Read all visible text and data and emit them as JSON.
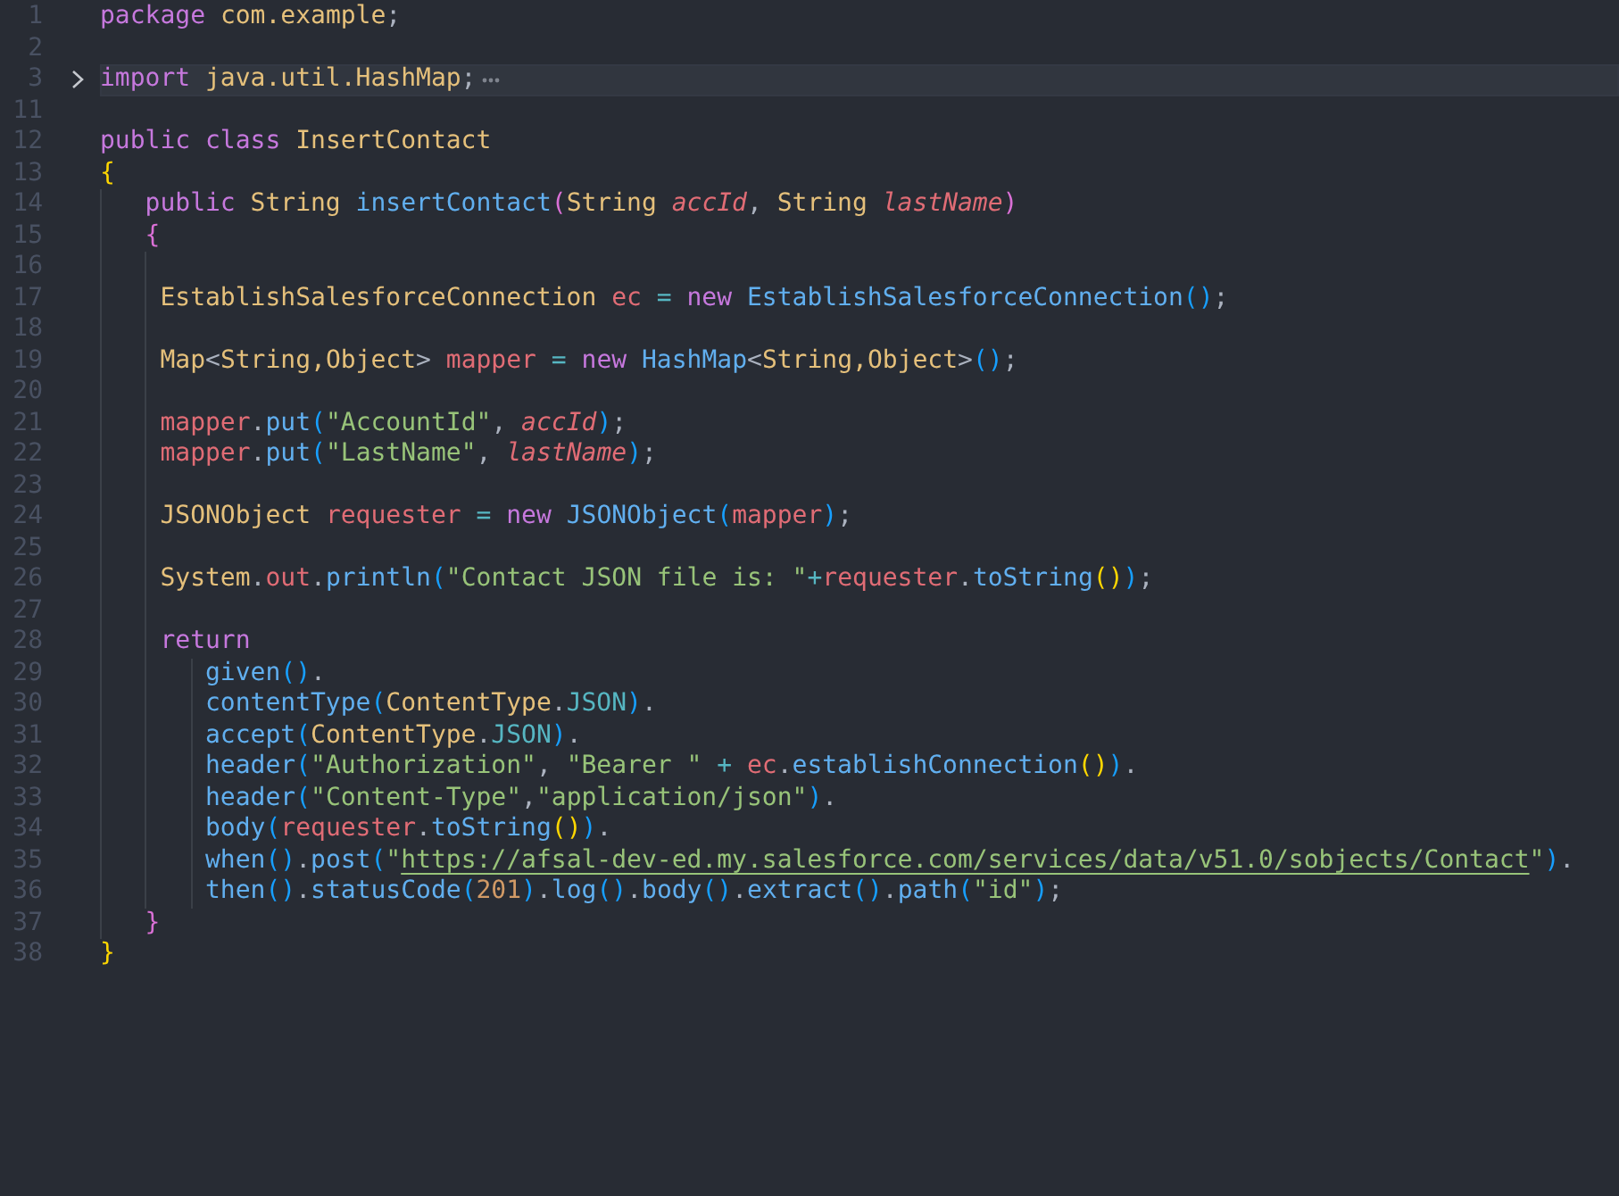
{
  "editor": {
    "lines": [
      {
        "number": "1",
        "current": false,
        "folded": false,
        "tokens": [
          {
            "kind": "kw",
            "text": "package"
          },
          {
            "kind": "type",
            "text": " com.example"
          },
          {
            "kind": "punct",
            "text": ";"
          }
        ]
      },
      {
        "number": "2",
        "current": false,
        "folded": false
      },
      {
        "number": "3",
        "current": true,
        "folded": true,
        "tokens": [
          {
            "kind": "kw",
            "text": "import"
          },
          {
            "kind": "type",
            "text": " java.util.HashMap"
          },
          {
            "kind": "punct",
            "text": ";"
          }
        ]
      },
      {
        "number": "11",
        "current": false,
        "folded": false
      },
      {
        "number": "12",
        "current": false,
        "folded": false,
        "tokens": [
          {
            "kind": "kw",
            "text": "public class"
          },
          {
            "kind": "type",
            "text": " InsertContact"
          }
        ]
      },
      {
        "number": "13",
        "current": false,
        "folded": false,
        "tokens": [
          {
            "kind": "brace1",
            "text": "{"
          }
        ]
      },
      {
        "number": "14",
        "current": false,
        "folded": false,
        "tokens": [
          {
            "kind": "kw",
            "text": "   public"
          },
          {
            "kind": "type",
            "text": " String"
          },
          {
            "kind": "fn",
            "text": " insertContact"
          },
          {
            "kind": "brace2",
            "text": "("
          },
          {
            "kind": "type",
            "text": "String"
          },
          {
            "kind": "param",
            "text": " accId"
          },
          {
            "kind": "punct",
            "text": ", "
          },
          {
            "kind": "type",
            "text": "String"
          },
          {
            "kind": "param",
            "text": " lastName"
          },
          {
            "kind": "brace2",
            "text": ")"
          }
        ]
      },
      {
        "number": "15",
        "current": false,
        "folded": false,
        "tokens": [
          {
            "kind": "brace2",
            "text": "   {"
          }
        ]
      },
      {
        "number": "16",
        "current": false,
        "folded": false
      },
      {
        "number": "17",
        "current": false,
        "folded": false,
        "tokens": [
          {
            "kind": "type",
            "text": "    EstablishSalesforceConnection"
          },
          {
            "kind": "var",
            "text": " ec"
          },
          {
            "kind": "op",
            "text": " = "
          },
          {
            "kind": "kw",
            "text": "new"
          },
          {
            "kind": "fn",
            "text": " EstablishSalesforceConnection"
          },
          {
            "kind": "brace3",
            "text": "()"
          },
          {
            "kind": "punct",
            "text": ";"
          }
        ]
      },
      {
        "number": "18",
        "current": false,
        "folded": false
      },
      {
        "number": "19",
        "current": false,
        "folded": false,
        "tokens": [
          {
            "kind": "type",
            "text": "    Map"
          },
          {
            "kind": "punct",
            "text": "<"
          },
          {
            "kind": "type",
            "text": "String,Object"
          },
          {
            "kind": "punct",
            "text": ">"
          },
          {
            "kind": "var",
            "text": " mapper"
          },
          {
            "kind": "op",
            "text": " = "
          },
          {
            "kind": "kw",
            "text": "new"
          },
          {
            "kind": "fn",
            "text": " HashMap"
          },
          {
            "kind": "punct",
            "text": "<"
          },
          {
            "kind": "type",
            "text": "String,Object"
          },
          {
            "kind": "punct",
            "text": ">"
          },
          {
            "kind": "brace3",
            "text": "()"
          },
          {
            "kind": "punct",
            "text": ";"
          }
        ]
      },
      {
        "number": "20",
        "current": false,
        "folded": false
      },
      {
        "number": "21",
        "current": false,
        "folded": false,
        "tokens": [
          {
            "kind": "var",
            "text": "    mapper"
          },
          {
            "kind": "punct",
            "text": "."
          },
          {
            "kind": "fn",
            "text": "put"
          },
          {
            "kind": "brace3",
            "text": "("
          },
          {
            "kind": "str",
            "text": "\"AccountId\""
          },
          {
            "kind": "punct",
            "text": ", "
          },
          {
            "kind": "param",
            "text": "accId"
          },
          {
            "kind": "brace3",
            "text": ")"
          },
          {
            "kind": "punct",
            "text": ";"
          }
        ]
      },
      {
        "number": "22",
        "current": false,
        "folded": false,
        "tokens": [
          {
            "kind": "var",
            "text": "    mapper"
          },
          {
            "kind": "punct",
            "text": "."
          },
          {
            "kind": "fn",
            "text": "put"
          },
          {
            "kind": "brace3",
            "text": "("
          },
          {
            "kind": "str",
            "text": "\"LastName\""
          },
          {
            "kind": "punct",
            "text": ", "
          },
          {
            "kind": "param",
            "text": "lastName"
          },
          {
            "kind": "brace3",
            "text": ")"
          },
          {
            "kind": "punct",
            "text": ";"
          }
        ]
      },
      {
        "number": "23",
        "current": false,
        "folded": false
      },
      {
        "number": "24",
        "current": false,
        "folded": false,
        "tokens": [
          {
            "kind": "type",
            "text": "    JSONObject"
          },
          {
            "kind": "var",
            "text": " requester"
          },
          {
            "kind": "op",
            "text": " = "
          },
          {
            "kind": "kw",
            "text": "new"
          },
          {
            "kind": "fn",
            "text": " JSONObject"
          },
          {
            "kind": "brace3",
            "text": "("
          },
          {
            "kind": "var",
            "text": "mapper"
          },
          {
            "kind": "brace3",
            "text": ")"
          },
          {
            "kind": "punct",
            "text": ";"
          }
        ]
      },
      {
        "number": "25",
        "current": false,
        "folded": false
      },
      {
        "number": "26",
        "current": false,
        "folded": false,
        "tokens": [
          {
            "kind": "type",
            "text": "    System"
          },
          {
            "kind": "punct",
            "text": "."
          },
          {
            "kind": "var",
            "text": "out"
          },
          {
            "kind": "punct",
            "text": "."
          },
          {
            "kind": "fn",
            "text": "println"
          },
          {
            "kind": "brace3",
            "text": "("
          },
          {
            "kind": "str",
            "text": "\"Contact JSON file is: \""
          },
          {
            "kind": "op",
            "text": "+"
          },
          {
            "kind": "var",
            "text": "requester"
          },
          {
            "kind": "punct",
            "text": "."
          },
          {
            "kind": "fn",
            "text": "toString"
          },
          {
            "kind": "brace1",
            "text": "()"
          },
          {
            "kind": "brace3",
            "text": ")"
          },
          {
            "kind": "punct",
            "text": ";"
          }
        ]
      },
      {
        "number": "27",
        "current": false,
        "folded": false
      },
      {
        "number": "28",
        "current": false,
        "folded": false,
        "tokens": [
          {
            "kind": "kw",
            "text": "    return"
          }
        ]
      },
      {
        "number": "29",
        "current": false,
        "folded": false,
        "tokens": [
          {
            "kind": "fn",
            "text": "       given"
          },
          {
            "kind": "brace3",
            "text": "()"
          },
          {
            "kind": "punct",
            "text": "."
          }
        ]
      },
      {
        "number": "30",
        "current": false,
        "folded": false,
        "tokens": [
          {
            "kind": "fn",
            "text": "       contentType"
          },
          {
            "kind": "brace3",
            "text": "("
          },
          {
            "kind": "type",
            "text": "ContentType"
          },
          {
            "kind": "punct",
            "text": "."
          },
          {
            "kind": "const",
            "text": "JSON"
          },
          {
            "kind": "brace3",
            "text": ")"
          },
          {
            "kind": "punct",
            "text": "."
          }
        ]
      },
      {
        "number": "31",
        "current": false,
        "folded": false,
        "tokens": [
          {
            "kind": "fn",
            "text": "       accept"
          },
          {
            "kind": "brace3",
            "text": "("
          },
          {
            "kind": "type",
            "text": "ContentType"
          },
          {
            "kind": "punct",
            "text": "."
          },
          {
            "kind": "const",
            "text": "JSON"
          },
          {
            "kind": "brace3",
            "text": ")"
          },
          {
            "kind": "punct",
            "text": "."
          }
        ]
      },
      {
        "number": "32",
        "current": false,
        "folded": false,
        "tokens": [
          {
            "kind": "fn",
            "text": "       header"
          },
          {
            "kind": "brace3",
            "text": "("
          },
          {
            "kind": "str",
            "text": "\"Authorization\""
          },
          {
            "kind": "punct",
            "text": ", "
          },
          {
            "kind": "str",
            "text": "\"Bearer \""
          },
          {
            "kind": "op",
            "text": " + "
          },
          {
            "kind": "var",
            "text": "ec"
          },
          {
            "kind": "punct",
            "text": "."
          },
          {
            "kind": "fn",
            "text": "establishConnection"
          },
          {
            "kind": "brace1",
            "text": "()"
          },
          {
            "kind": "brace3",
            "text": ")"
          },
          {
            "kind": "punct",
            "text": "."
          }
        ]
      },
      {
        "number": "33",
        "current": false,
        "folded": false,
        "tokens": [
          {
            "kind": "fn",
            "text": "       header"
          },
          {
            "kind": "brace3",
            "text": "("
          },
          {
            "kind": "str",
            "text": "\"Content-Type\""
          },
          {
            "kind": "punct",
            "text": ","
          },
          {
            "kind": "str",
            "text": "\"application/json\""
          },
          {
            "kind": "brace3",
            "text": ")"
          },
          {
            "kind": "punct",
            "text": "."
          }
        ]
      },
      {
        "number": "34",
        "current": false,
        "folded": false,
        "tokens": [
          {
            "kind": "fn",
            "text": "       body"
          },
          {
            "kind": "brace3",
            "text": "("
          },
          {
            "kind": "var",
            "text": "requester"
          },
          {
            "kind": "punct",
            "text": "."
          },
          {
            "kind": "fn",
            "text": "toString"
          },
          {
            "kind": "brace1",
            "text": "()"
          },
          {
            "kind": "brace3",
            "text": ")"
          },
          {
            "kind": "punct",
            "text": "."
          }
        ]
      },
      {
        "number": "35",
        "current": false,
        "folded": false,
        "tokens": [
          {
            "kind": "fn",
            "text": "       when"
          },
          {
            "kind": "brace3",
            "text": "()"
          },
          {
            "kind": "punct",
            "text": "."
          },
          {
            "kind": "fn",
            "text": "post"
          },
          {
            "kind": "brace3",
            "text": "("
          },
          {
            "kind": "str",
            "text": "\""
          },
          {
            "kind": "link",
            "text": "https://afsal-dev-ed.my.salesforce.com/services/data/v51.0/sobjects/Contact"
          },
          {
            "kind": "str",
            "text": "\""
          },
          {
            "kind": "brace3",
            "text": ")"
          },
          {
            "kind": "punct",
            "text": "."
          }
        ]
      },
      {
        "number": "36",
        "current": false,
        "folded": false,
        "tokens": [
          {
            "kind": "fn",
            "text": "       then"
          },
          {
            "kind": "brace3",
            "text": "()"
          },
          {
            "kind": "punct",
            "text": "."
          },
          {
            "kind": "fn",
            "text": "statusCode"
          },
          {
            "kind": "brace3",
            "text": "("
          },
          {
            "kind": "num",
            "text": "201"
          },
          {
            "kind": "brace3",
            "text": ")"
          },
          {
            "kind": "punct",
            "text": "."
          },
          {
            "kind": "fn",
            "text": "log"
          },
          {
            "kind": "brace3",
            "text": "()"
          },
          {
            "kind": "punct",
            "text": "."
          },
          {
            "kind": "fn",
            "text": "body"
          },
          {
            "kind": "brace3",
            "text": "()"
          },
          {
            "kind": "punct",
            "text": "."
          },
          {
            "kind": "fn",
            "text": "extract"
          },
          {
            "kind": "brace3",
            "text": "()"
          },
          {
            "kind": "punct",
            "text": "."
          },
          {
            "kind": "fn",
            "text": "path"
          },
          {
            "kind": "brace3",
            "text": "("
          },
          {
            "kind": "str",
            "text": "\"id\""
          },
          {
            "kind": "brace3",
            "text": ")"
          },
          {
            "kind": "punct",
            "text": ";"
          }
        ]
      },
      {
        "number": "37",
        "current": false,
        "folded": false,
        "tokens": [
          {
            "kind": "brace2",
            "text": "   }"
          }
        ]
      },
      {
        "number": "38",
        "current": false,
        "folded": false,
        "tokens": [
          {
            "kind": "brace1",
            "text": "}"
          }
        ]
      }
    ]
  }
}
